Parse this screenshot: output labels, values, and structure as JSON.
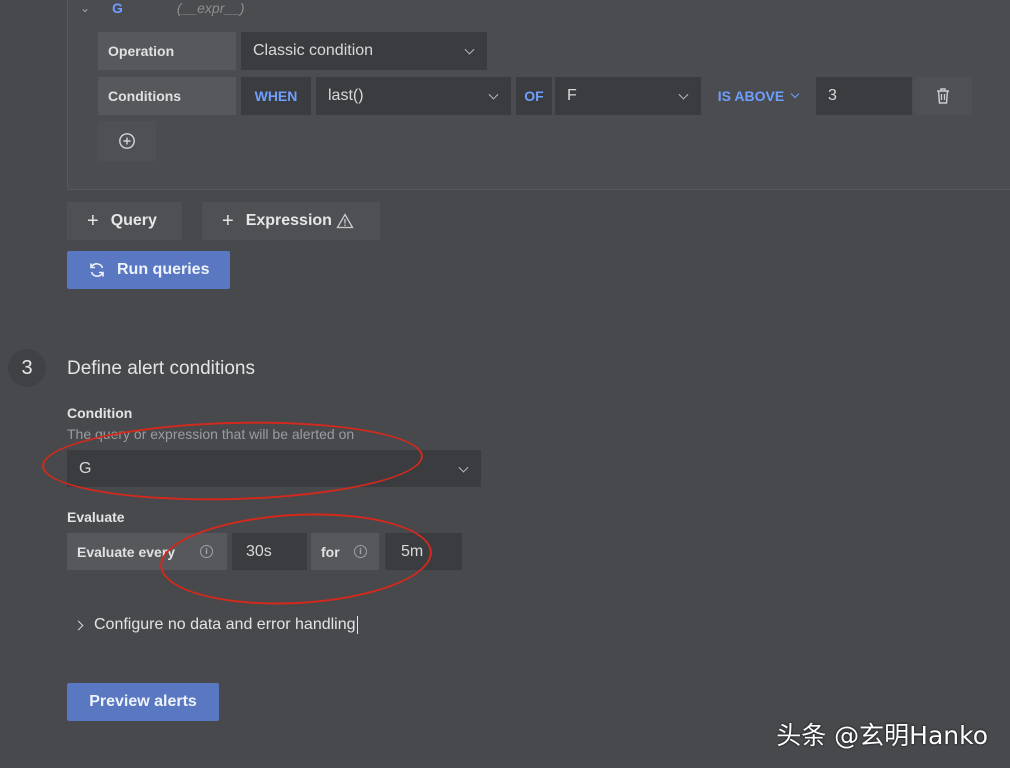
{
  "query": {
    "ref_id": "G",
    "expr_hint": "(__expr__)",
    "operation_label": "Operation",
    "operation_value": "Classic condition",
    "conditions_label": "Conditions",
    "when_kw": "WHEN",
    "reducer": "last()",
    "of_kw": "OF",
    "query_ref": "F",
    "evaluator": "IS ABOVE",
    "threshold": "3"
  },
  "actions": {
    "add_query": "Query",
    "add_expression": "Expression",
    "run_queries": "Run queries"
  },
  "section": {
    "step_number": "3",
    "title": "Define alert conditions"
  },
  "condition": {
    "label": "Condition",
    "description": "The query or expression that will be alerted on",
    "value": "G"
  },
  "evaluate": {
    "label": "Evaluate",
    "every_label": "Evaluate every",
    "every_value": "30s",
    "for_label": "for",
    "for_value": "5m"
  },
  "no_data": {
    "label": "Configure no data and error handling"
  },
  "preview_button": "Preview alerts",
  "watermark": "头条 @玄明Hanko",
  "colors": {
    "background": "#47494c",
    "accent": "#6e9fff",
    "primary_button": "#5a78c1",
    "annotation": "#d4291c"
  }
}
